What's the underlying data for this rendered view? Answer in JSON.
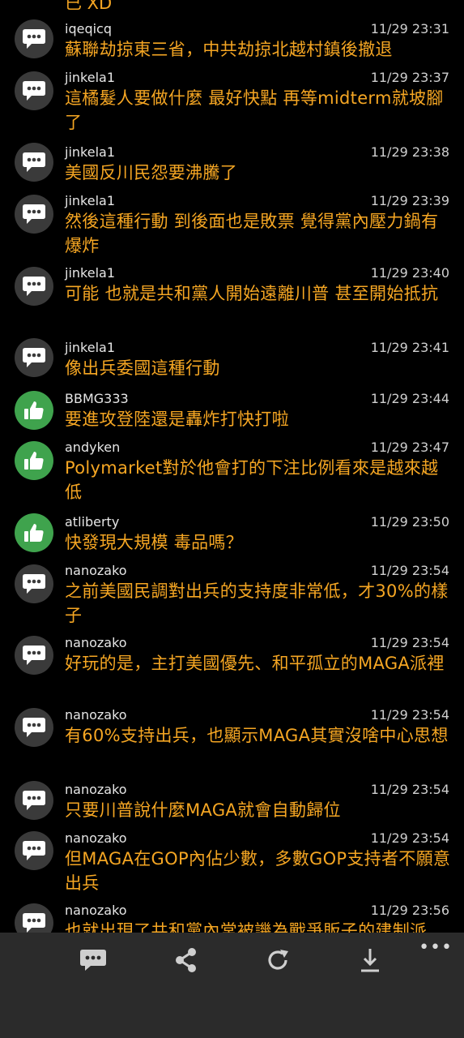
{
  "top_cut_text": "已 XD",
  "comments": [
    {
      "user": "iqeqicq",
      "time": "11/29 23:31",
      "type": "comment",
      "text": "蘇聯劫掠東三省，中共劫掠北越村鎮後撤退"
    },
    {
      "user": "jinkela1",
      "time": "11/29 23:37",
      "type": "comment",
      "text": "這橘髮人要做什麼 最好快點 再等midterm就坡腳了"
    },
    {
      "user": "jinkela1",
      "time": "11/29 23:38",
      "type": "comment",
      "text": "美國反川民怨要沸騰了"
    },
    {
      "user": "jinkela1",
      "time": "11/29 23:39",
      "type": "comment",
      "text": "然後這種行動 到後面也是敗票 覺得黨內壓力鍋有爆炸"
    },
    {
      "user": "jinkela1",
      "time": "11/29 23:40",
      "type": "comment",
      "text": "可能 也就是共和黨人開始遠離川普 甚至開始抵抗"
    },
    {
      "user": "jinkela1",
      "time": "11/29 23:41",
      "type": "comment",
      "text": "像出兵委國這種行動"
    },
    {
      "user": "BBMG333",
      "time": "11/29 23:44",
      "type": "upvote",
      "text": "要進攻登陸還是轟炸打快打啦"
    },
    {
      "user": "andyken",
      "time": "11/29 23:47",
      "type": "upvote",
      "text": "Polymarket對於他會打的下注比例看來是越來越低"
    },
    {
      "user": "atliberty",
      "time": "11/29 23:50",
      "type": "upvote",
      "text": "快發現大規模 毒品嗎？"
    },
    {
      "user": "nanozako",
      "time": "11/29 23:54",
      "type": "comment",
      "text": "之前美國民調對出兵的支持度非常低，才30%的樣子"
    },
    {
      "user": "nanozako",
      "time": "11/29 23:54",
      "type": "comment",
      "text": "好玩的是，主打美國優先、和平孤立的MAGA派裡"
    },
    {
      "user": "nanozako",
      "time": "11/29 23:54",
      "type": "comment",
      "text": "有60%支持出兵，也顯示MAGA其實沒啥中心思想"
    },
    {
      "user": "nanozako",
      "time": "11/29 23:54",
      "type": "comment",
      "text": "只要川普說什麼MAGA就會自動歸位"
    },
    {
      "user": "nanozako",
      "time": "11/29 23:54",
      "type": "comment",
      "text": "但MAGA在GOP內佔少數，多數GOP支持者不願意出兵"
    },
    {
      "user": "nanozako",
      "time": "11/29 23:56",
      "type": "comment",
      "text": "也就出現了共和黨內常被譏為戰爭販子的建制派"
    }
  ],
  "toolbar": {
    "icons": [
      "chat-icon",
      "share-icon",
      "refresh-icon",
      "download-icon",
      "more-icon"
    ],
    "more_label": "•••"
  },
  "colors": {
    "comment_text": "#f5a623",
    "upvote_badge": "#3fa34d",
    "comment_badge": "#3a3a3a",
    "toolbar_bg": "#2b2b2b"
  }
}
